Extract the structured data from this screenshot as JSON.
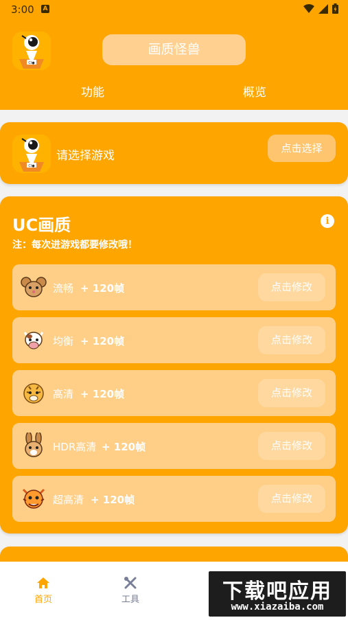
{
  "status_bar": {
    "time": "3:00",
    "notif_letter": "A"
  },
  "header": {
    "app_title": "画质怪兽",
    "tabs": [
      "功能",
      "概览"
    ]
  },
  "game_select": {
    "prompt": "请选择游戏",
    "button": "点击选择"
  },
  "uc_quality": {
    "title": "UC画质",
    "note": "注：每次进游戏都要修改哦！",
    "options": [
      {
        "name": "流畅",
        "fps": "+ 120帧",
        "button": "点击修改",
        "icon": "mouse-icon"
      },
      {
        "name": "均衡",
        "fps": "+ 120帧",
        "button": "点击修改",
        "icon": "cow-icon"
      },
      {
        "name": "高清",
        "fps": "+ 120帧",
        "button": "点击修改",
        "icon": "tiger-icon"
      },
      {
        "name": "HDR高清",
        "fps": "+ 120帧",
        "button": "点击修改",
        "icon": "rabbit-icon"
      },
      {
        "name": "超高清",
        "fps": "+ 120帧",
        "button": "点击修改",
        "icon": "dragon-icon"
      }
    ]
  },
  "bottom_nav": {
    "items": [
      "首页",
      "工具"
    ],
    "active_color": "#ffa500",
    "inactive_color": "#7a7f99"
  },
  "watermark": {
    "main": "下载吧应用",
    "sub": "www.xiazaiba.com"
  },
  "colors": {
    "accent": "#ffa500",
    "row_bg": "#ffcf88",
    "pill": "#ffd090"
  }
}
